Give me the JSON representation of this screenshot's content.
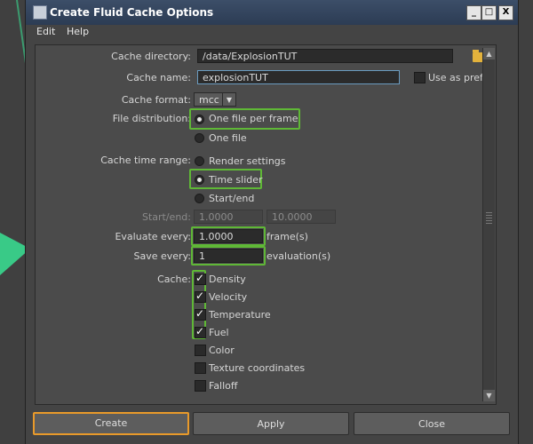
{
  "window": {
    "title": "Create Fluid Cache Options",
    "buttons": {
      "minimize": "_",
      "maximize": "□",
      "close": "X"
    }
  },
  "menu": [
    "Edit",
    "Help"
  ],
  "form": {
    "cache_directory": {
      "label": "Cache directory:",
      "value": "/data/ExplosionTUT"
    },
    "cache_name": {
      "label": "Cache name:",
      "value": "explosionTUT",
      "use_as_prefix": "Use as prefix"
    },
    "cache_format": {
      "label": "Cache format:",
      "value": "mcc"
    },
    "file_distribution": {
      "label": "File distribution:",
      "options": [
        "One file per frame",
        "One file"
      ],
      "selected": "One file per frame"
    },
    "cache_time_range": {
      "label": "Cache time range:",
      "options": [
        "Render settings",
        "Time slider",
        "Start/end"
      ],
      "selected": "Time slider"
    },
    "start_end": {
      "label": "Start/end:",
      "start": "1.0000",
      "end": "10.0000"
    },
    "evaluate_every": {
      "label": "Evaluate every:",
      "value": "1.0000",
      "unit": "frame(s)"
    },
    "save_every": {
      "label": "Save every:",
      "value": "1",
      "unit": "evaluation(s)"
    },
    "cache": {
      "label": "Cache:",
      "items": [
        {
          "label": "Density",
          "checked": true
        },
        {
          "label": "Velocity",
          "checked": true
        },
        {
          "label": "Temperature",
          "checked": true
        },
        {
          "label": "Fuel",
          "checked": true
        },
        {
          "label": "Color",
          "checked": false
        },
        {
          "label": "Texture coordinates",
          "checked": false
        },
        {
          "label": "Falloff",
          "checked": false
        }
      ]
    }
  },
  "actions": {
    "create": "Create",
    "apply": "Apply",
    "close": "Close"
  },
  "colors": {
    "highlight_green": "#5fb836",
    "highlight_orange": "#e99a2a",
    "folder": "#e3b23c"
  }
}
